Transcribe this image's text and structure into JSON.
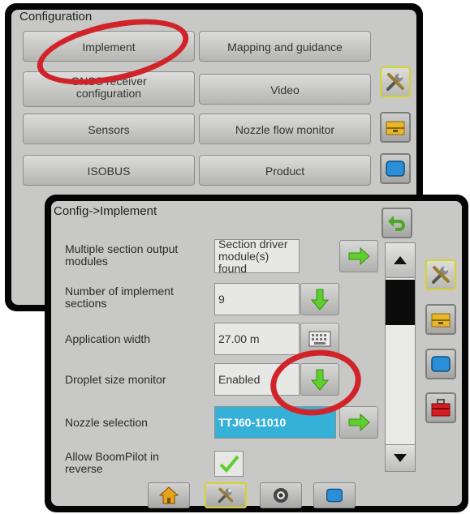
{
  "config_screen": {
    "title": "Configuration",
    "buttons": [
      {
        "label": "Implement"
      },
      {
        "label": "Mapping and guidance"
      },
      {
        "label": "GNSS receiver configuration"
      },
      {
        "label": "Video"
      },
      {
        "label": "Sensors"
      },
      {
        "label": "Nozzle flow monitor"
      },
      {
        "label": "ISOBUS"
      },
      {
        "label": "Product"
      }
    ]
  },
  "implement_screen": {
    "breadcrumb": "Config->Implement",
    "rows": [
      {
        "label": "Multiple section output modules",
        "value": "Section driver module(s) found",
        "action_icon": "arrow-right-icon"
      },
      {
        "label": "Number of implement sections",
        "value": "9",
        "action_icon": "arrow-down-icon"
      },
      {
        "label": "Application width",
        "value": "27.00 m",
        "action_icon": "keyboard-icon"
      },
      {
        "label": "Droplet size monitor",
        "value": "Enabled",
        "action_icon": "arrow-down-icon"
      },
      {
        "label": "Nozzle selection",
        "value": "TTJ60-11010",
        "action_icon": "arrow-right-icon"
      },
      {
        "label": "Allow BoomPilot in reverse",
        "value": "checked",
        "action_icon": "checkbox-icon"
      }
    ]
  },
  "side_tabs": [
    "tools-icon",
    "drawer-icon",
    "display-icon",
    "toolbox-icon"
  ],
  "bottom_tabs": [
    "home-icon",
    "tools-icon",
    "camera-icon",
    "display-icon"
  ],
  "colors": {
    "highlight_ellipse": "#d1232a",
    "active_border": "#d6d22e",
    "accent_blue": "#35b1d7",
    "arrow_green": "#5fcf2e"
  }
}
